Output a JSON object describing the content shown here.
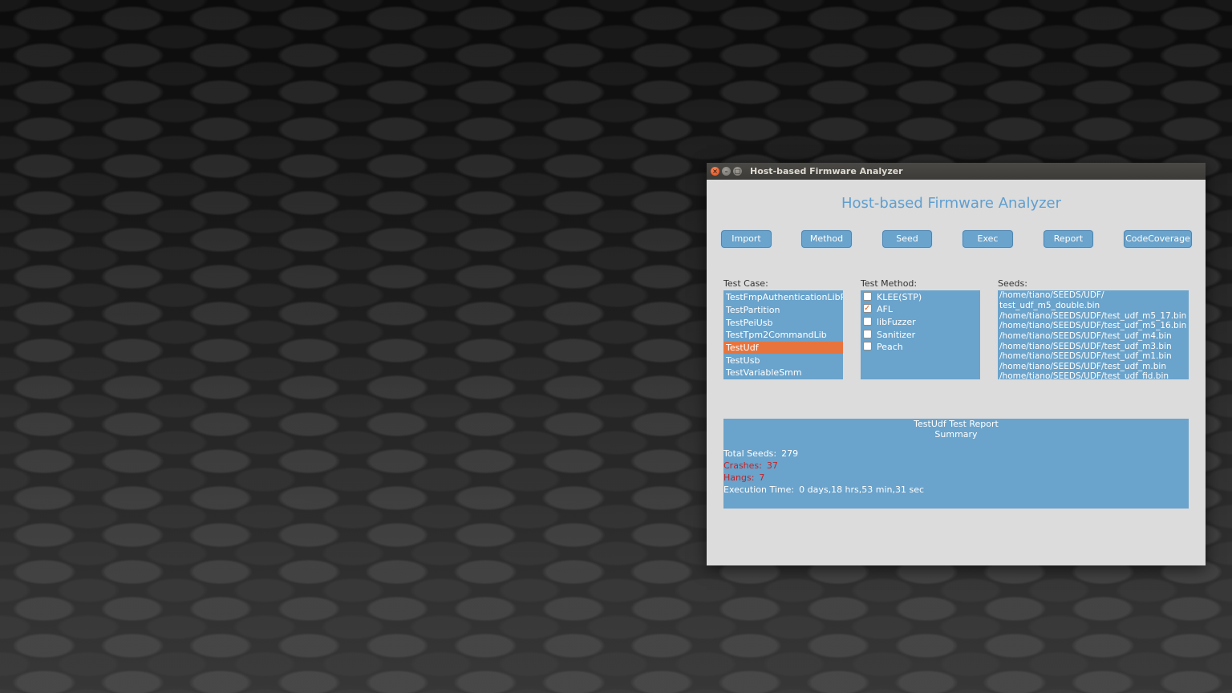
{
  "window": {
    "title": "Host-based Firmware Analyzer"
  },
  "app": {
    "heading": "Host-based Firmware Analyzer"
  },
  "toolbar": {
    "buttons": [
      "Import",
      "Method",
      "Seed",
      "Exec",
      "Report",
      "CodeCoverage"
    ]
  },
  "test_case": {
    "label": "Test Case:",
    "items": [
      "TestFmpAuthenticationLibRsa",
      "TestPartition",
      "TestPeiUsb",
      "TestTpm2CommandLib",
      "TestUdf",
      "TestUsb",
      "TestVariableSmm"
    ],
    "selected": "TestUdf"
  },
  "test_method": {
    "label": "Test Method:",
    "items": [
      {
        "label": "KLEE(STP)",
        "checked": false
      },
      {
        "label": "AFL",
        "checked": true
      },
      {
        "label": "libFuzzer",
        "checked": false
      },
      {
        "label": "Sanitizer",
        "checked": false
      },
      {
        "label": "Peach",
        "checked": false
      }
    ]
  },
  "seeds": {
    "label": "Seeds:",
    "items": [
      "/home/tiano/SEEDS/UDF/",
      "test_udf_m5_double.bin",
      "/home/tiano/SEEDS/UDF/test_udf_m5_17.bin",
      "/home/tiano/SEEDS/UDF/test_udf_m5_16.bin",
      "/home/tiano/SEEDS/UDF/test_udf_m4.bin",
      "/home/tiano/SEEDS/UDF/test_udf_m3.bin",
      "/home/tiano/SEEDS/UDF/test_udf_m1.bin",
      "/home/tiano/SEEDS/UDF/test_udf_m.bin",
      "/home/tiano/SEEDS/UDF/test_udf_fid.bin"
    ]
  },
  "report": {
    "title": "TestUdf Test Report",
    "subtitle": "Summary",
    "total_seeds_label": "Total Seeds:",
    "total_seeds": "279",
    "crashes_label": "Crashes:",
    "crashes": "37",
    "hangs_label": "Hangs:",
    "hangs": "7",
    "exec_time_label": "Execution Time:",
    "exec_time": "0 days,18 hrs,53 min,31 sec"
  },
  "colors": {
    "accent": "#6aa3cb",
    "selection": "#e8743d",
    "alert": "#c0262a",
    "heading": "#5f9fd0"
  }
}
